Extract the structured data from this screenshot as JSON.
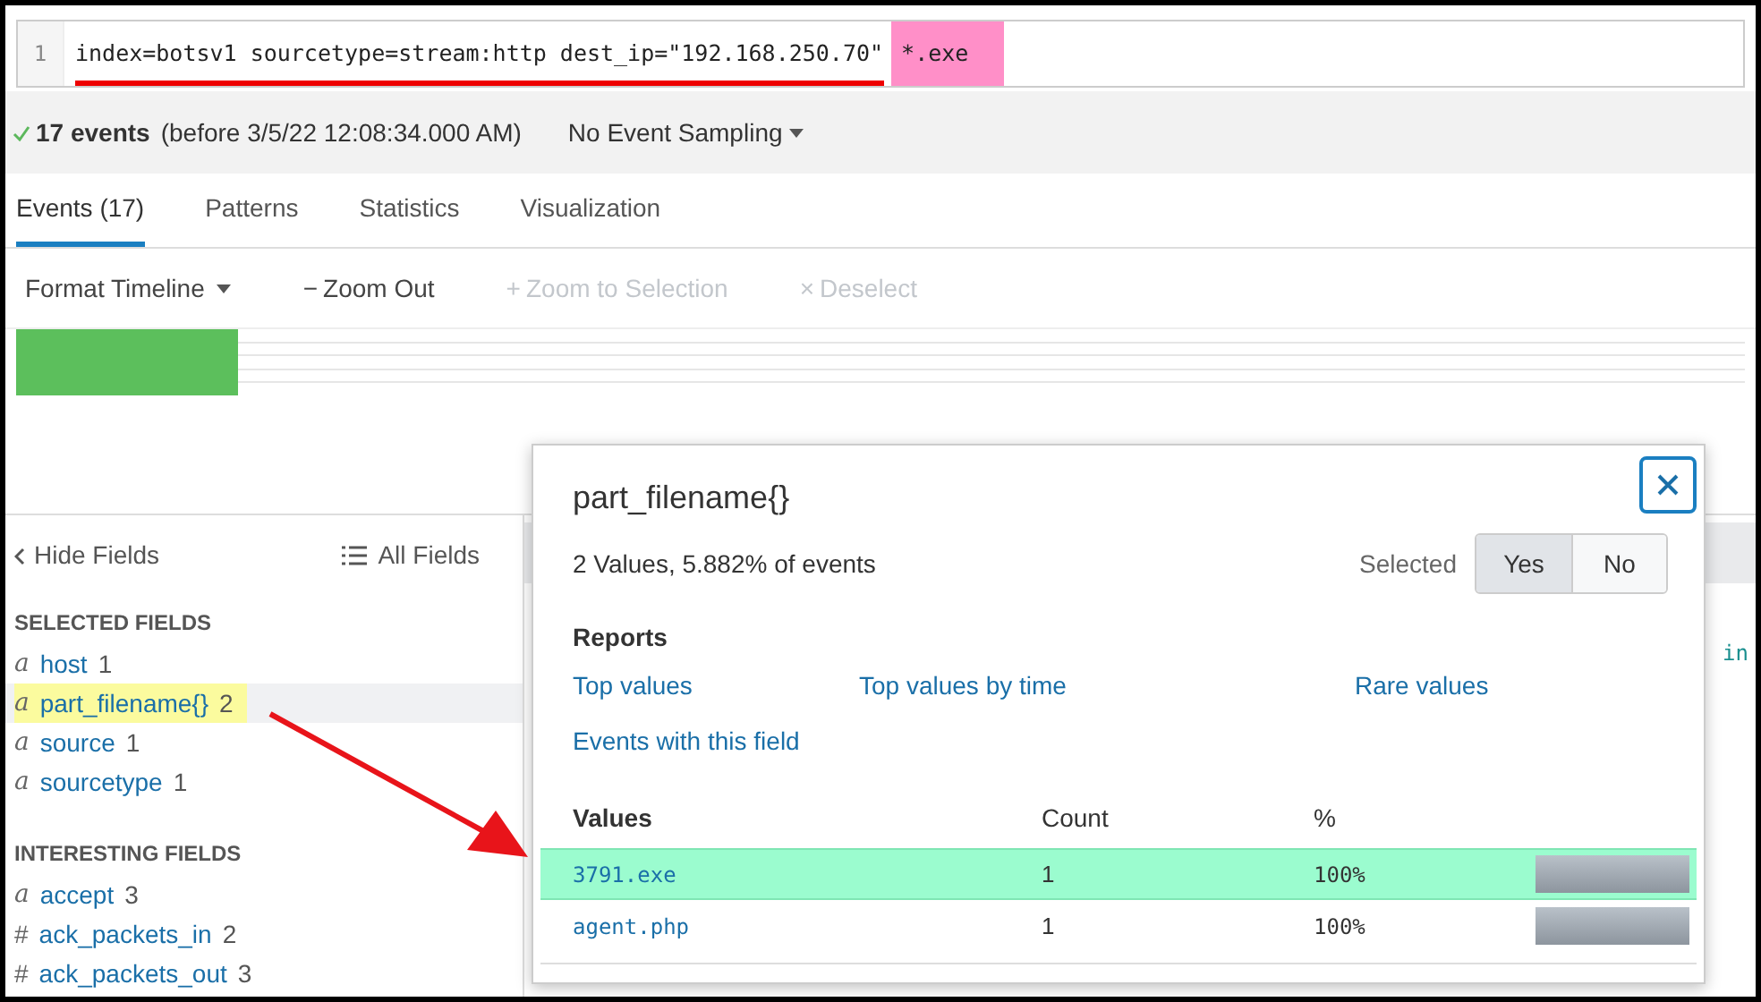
{
  "query": {
    "line_number": "1",
    "parts": [
      {
        "text": "index=botsv1 sourcetype=stream:http dest_ip=\"192.168.250.70\"",
        "highlighted": false
      },
      {
        "text": "*.exe",
        "highlighted": true
      }
    ]
  },
  "summary": {
    "count": "17 events",
    "detail": "(before 3/5/22 12:08:34.000 AM)",
    "sampling": "No Event Sampling"
  },
  "tabs": [
    {
      "label": "Events (17)",
      "selected": true
    },
    {
      "label": "Patterns",
      "selected": false
    },
    {
      "label": "Statistics",
      "selected": false
    },
    {
      "label": "Visualization",
      "selected": false
    }
  ],
  "timeline_toolbar": [
    {
      "kind": "dropdown",
      "label": "Format Timeline",
      "disabled": false
    },
    {
      "kind": "action",
      "icon": "−",
      "label": "Zoom Out",
      "disabled": false
    },
    {
      "kind": "action",
      "icon": "+",
      "label": "Zoom to Selection",
      "disabled": true
    },
    {
      "kind": "action",
      "icon": "×",
      "label": "Deselect",
      "disabled": true
    }
  ],
  "sidebar": {
    "hide_fields": "Hide Fields",
    "all_fields": "All Fields",
    "sections": [
      {
        "heading": "SELECTED FIELDS",
        "fields": [
          {
            "type": "a",
            "name": "host",
            "count": "1",
            "selected": false
          },
          {
            "type": "a",
            "name": "part_filename{}",
            "count": "2",
            "selected": true
          },
          {
            "type": "a",
            "name": "source",
            "count": "1",
            "selected": false
          },
          {
            "type": "a",
            "name": "sourcetype",
            "count": "1",
            "selected": false
          }
        ]
      },
      {
        "heading": "INTERESTING FIELDS",
        "fields": [
          {
            "type": "a",
            "name": "accept",
            "count": "3",
            "selected": false
          },
          {
            "type": "#",
            "name": "ack_packets_in",
            "count": "2",
            "selected": false
          },
          {
            "type": "#",
            "name": "ack_packets_out",
            "count": "3",
            "selected": false
          }
        ]
      }
    ]
  },
  "event_fragment": "in",
  "popup": {
    "title": "part_filename{}",
    "summary": "2 Values, 5.882% of events",
    "selected_label": "Selected",
    "toggle": [
      {
        "label": "Yes",
        "selected": true
      },
      {
        "label": "No",
        "selected": false
      }
    ],
    "reports_heading": "Reports",
    "reports": [
      "Top values",
      "Top values by time",
      "Rare values",
      "Events with this field"
    ],
    "columns": [
      "Values",
      "Count",
      "%"
    ],
    "rows": [
      {
        "value": "3791.exe",
        "count": "1",
        "percent": "100%",
        "level": 1,
        "highlighted": true
      },
      {
        "value": "agent.php",
        "count": "1",
        "percent": "100%",
        "level": 1,
        "highlighted": false
      }
    ]
  }
}
